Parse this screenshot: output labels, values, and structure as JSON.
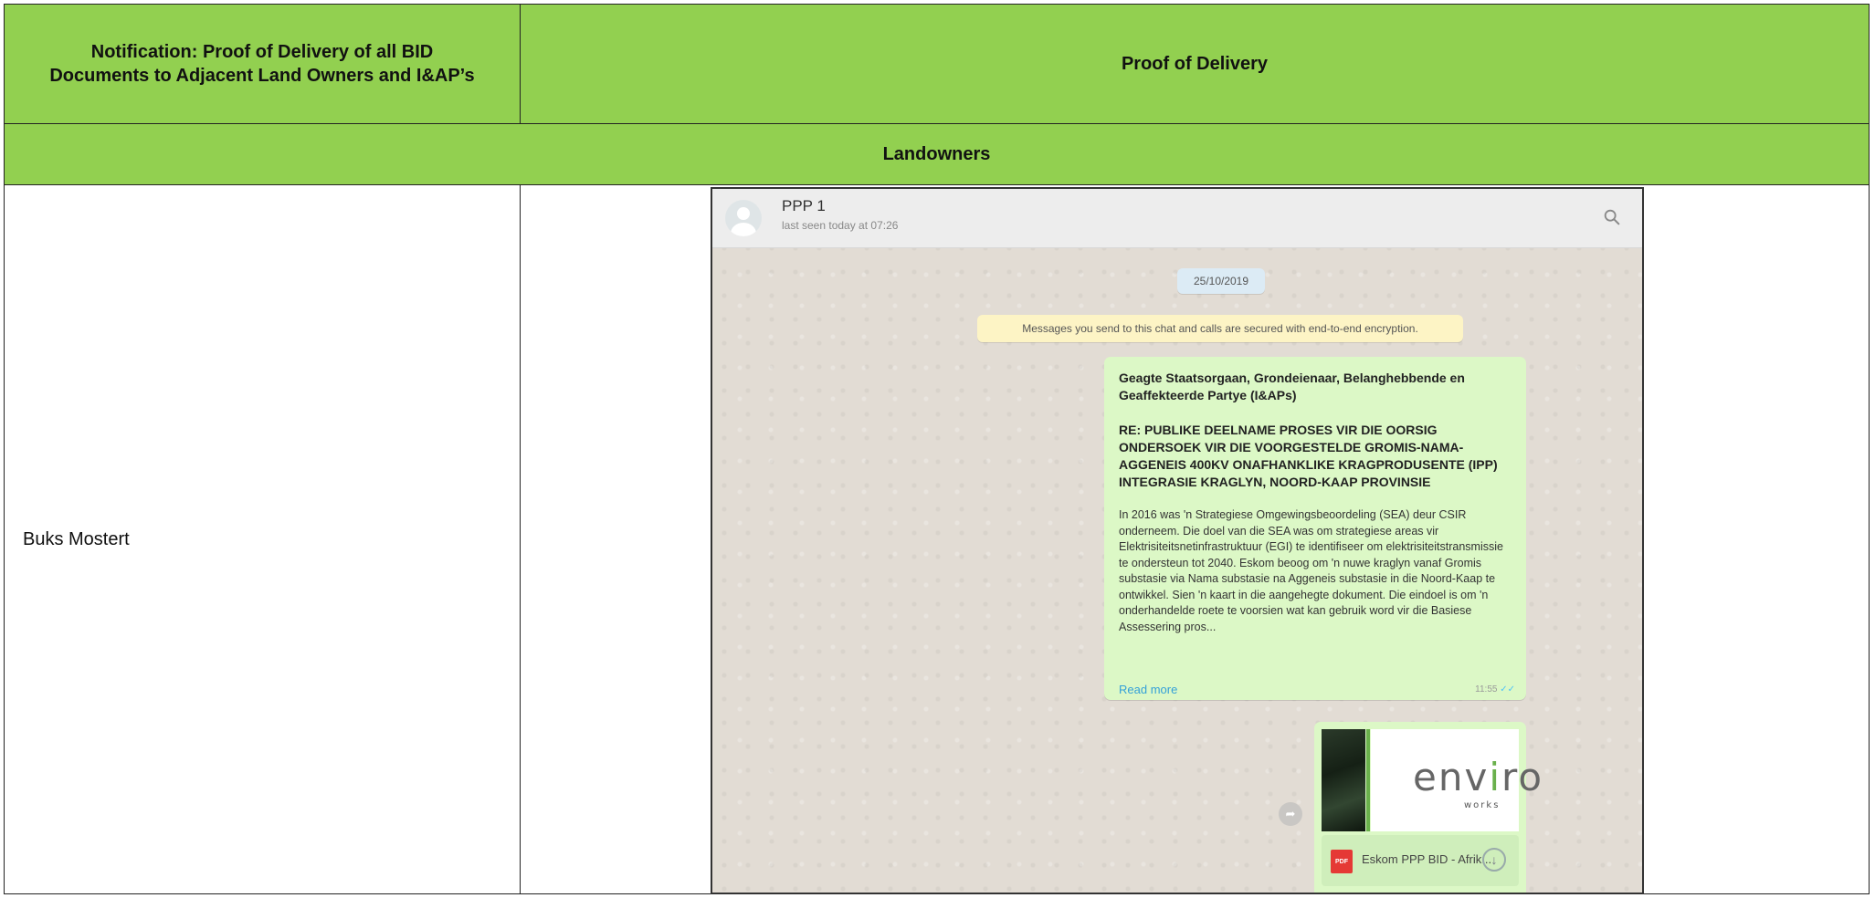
{
  "table": {
    "header_left": "Notification: Proof of Delivery of all BID Documents to Adjacent Land Owners and I&AP’s",
    "header_right": "Proof of Delivery",
    "section_title": "Landowners",
    "rows": [
      {
        "name": "Buks Mostert"
      }
    ]
  },
  "colors": {
    "header_green": "#92d050",
    "chat_bubble": "#dcf8c6",
    "chat_background": "#e2dcd4"
  },
  "whatsapp": {
    "contact_name": "PPP 1",
    "last_seen": "last seen today at 07:26",
    "search_icon": "search-icon",
    "date": "25/10/2019",
    "encryption_notice": "Messages you send to this chat and calls are secured with end-to-end encryption.",
    "message": {
      "greeting": "Geagte Staatsorgaan, Grondeienaar, Belanghebbende en Geaffekteerde Partye (I&APs)",
      "subject": "RE: PUBLIKE DEELNAME PROSES VIR DIE OORSIG ONDERSOEK VIR DIE VOORGESTELDE GROMIS-NAMA-AGGENEIS 400KV ONAFHANKLIKE KRAGPRODUSENTE (IPP) INTEGRASIE KRAGLYN, NOORD-KAAP PROVINSIE",
      "body": "In 2016 was 'n Strategiese Omgewingsbeoordeling (SEA) deur CSIR onderneem. Die doel van die SEA was om strategiese areas vir Elektrisiteitsnetinfrastruktuur (EGI) te identifiseer om elektrisiteitstransmissie te ondersteun tot 2040. Eskom beoog om 'n nuwe kraglyn vanaf Gromis substasie via Nama substasie na Aggeneis substasie in die Noord-Kaap te ontwikkel. Sien 'n kaart in die aangehegte dokument. Die eindoel is om 'n onderhandelde roete te voorsien wat kan gebruik word vir die Basiese Assessering pros...",
      "read_more": "Read more",
      "time": "11:55",
      "ticks": "✓✓"
    },
    "attachment": {
      "logo_main_1": "env",
      "logo_main_i": "i",
      "logo_main_2": "ro",
      "logo_sub": "works",
      "file_type": "PDF",
      "file_name": "Eskom PPP BID - Afrik...",
      "forward_glyph": "➦"
    }
  }
}
